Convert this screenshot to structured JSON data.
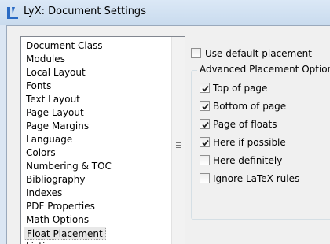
{
  "window": {
    "title": "LyX: Document Settings"
  },
  "categories": [
    "Document Class",
    "Modules",
    "Local Layout",
    "Fonts",
    "Text Layout",
    "Page Layout",
    "Page Margins",
    "Language",
    "Colors",
    "Numbering & TOC",
    "Bibliography",
    "Indexes",
    "PDF Properties",
    "Math Options",
    "Float Placement",
    "Listings"
  ],
  "selected_category": "Float Placement",
  "use_default": {
    "label": "Use default placement",
    "checked": false
  },
  "advanced": {
    "title": "Advanced Placement Options",
    "options": [
      {
        "label": "Top of page",
        "checked": true
      },
      {
        "label": "Bottom of page",
        "checked": true
      },
      {
        "label": "Page of floats",
        "checked": true
      },
      {
        "label": "Here if possible",
        "checked": true
      },
      {
        "label": "Here definitely",
        "checked": false
      },
      {
        "label": "Ignore LaTeX rules",
        "checked": false
      }
    ]
  }
}
